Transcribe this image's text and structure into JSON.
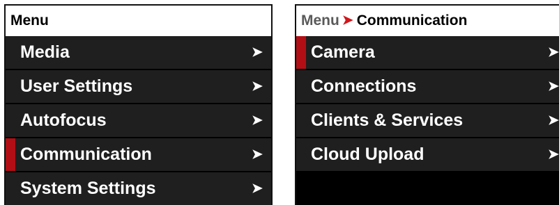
{
  "left_panel": {
    "title": "Menu",
    "items": [
      {
        "label": "Media",
        "chevron": "➤",
        "selected": false
      },
      {
        "label": "User Settings",
        "chevron": "➤",
        "selected": false
      },
      {
        "label": "Autofocus",
        "chevron": "➤",
        "selected": false
      },
      {
        "label": "Communication",
        "chevron": "➤",
        "selected": true
      },
      {
        "label": "System Settings",
        "chevron": "➤",
        "selected": false
      }
    ]
  },
  "right_panel": {
    "breadcrumb": {
      "parent": "Menu",
      "separator": "➤",
      "current": "Communication"
    },
    "items": [
      {
        "label": "Camera",
        "chevron": "➤",
        "selected": true
      },
      {
        "label": "Connections",
        "chevron": "➤",
        "selected": false
      },
      {
        "label": "Clients & Services",
        "chevron": "➤",
        "selected": false
      },
      {
        "label": "Cloud Upload",
        "chevron": "➤",
        "selected": false
      }
    ]
  },
  "colors": {
    "selection_indicator": "#b10f15",
    "breadcrumb_separator": "#d0161b",
    "item_background": "#1f1f1f",
    "panel_background": "#000000"
  }
}
